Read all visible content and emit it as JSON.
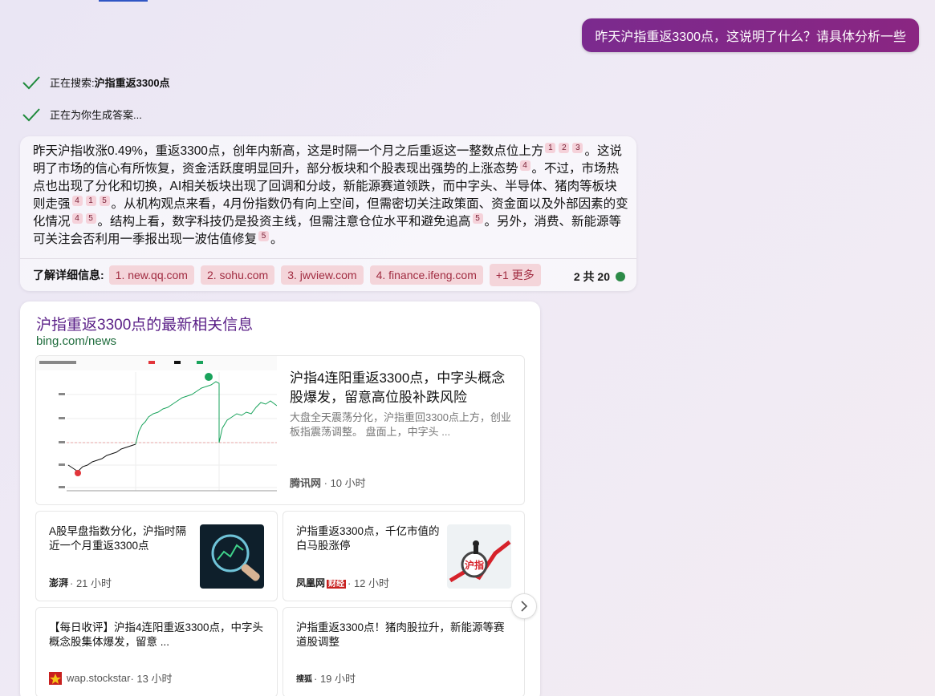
{
  "user_message": "昨天沪指重返3300点，这说明了什么？请具体分析一些",
  "status": {
    "searching_prefix": "正在搜索: ",
    "searching_query": "沪指重返3300点",
    "generating": "正在为你生成答案..."
  },
  "answer": {
    "s1": "昨天沪指收涨0.49%，重返3300点，创年内新高，这是时隔一个月之后重返这一整数点位上方",
    "s2": "。这说明了市场的信心有所恢复，资金活跃度明显回升，部分板块和个股表现出强势的上涨态势",
    "s3": "。不过，市场热点也出现了分化和切换，AI相关板块出现了回调和分歧，新能源赛道领跌，而中字头、半导体、猪肉等板块则走强",
    "s4": "。从机构观点来看，4月份指数仍有向上空间，但需密切关注政策面、资金面以及外部因素的变化情况",
    "s5": "。结构上看，数字科技仍是投资主线，但需注意仓位水平和避免追高",
    "s6": "。另外，消费、新能源等可关注会否利用一季报出现一波估值修复",
    "s7": "。",
    "cites": [
      "1",
      "2",
      "3",
      "4",
      "4",
      "1",
      "5",
      "4",
      "5",
      "5",
      "5"
    ]
  },
  "learn_more": {
    "label": "了解详细信息:",
    "chips": [
      "1. new.qq.com",
      "2. sohu.com",
      "3. jwview.com",
      "4. finance.ifeng.com",
      "+1 更多"
    ],
    "count": "2 共 20"
  },
  "news": {
    "title": "沪指重返3300点的最新相关信息",
    "source": "bing.com/news",
    "feature": {
      "title": "沪指4连阳重返3300点，中字头概念股爆发，留意高位股补跌风险",
      "snippet": "大盘全天震荡分化，沪指重回3300点上方，创业板指震荡调整。 盘面上，中字头 ...",
      "source": "腾讯网",
      "time": " · 10 小时"
    },
    "cards": [
      {
        "title": "A股早盘指数分化，沪指时隔近一个月重返3300点",
        "source": "澎湃",
        "time": " · 21 小时"
      },
      {
        "title": "沪指重返3300点，千亿市值的白马股涨停",
        "source": "凤凰网",
        "source_tag": "财经",
        "time": " · 12 小时",
        "thumb_text": "沪指"
      },
      {
        "title": "【每日收评】沪指4连阳重返3300点，中字头概念股集体爆发，留意 ...",
        "source": "wap.stockstar",
        "time": " · 13 小时"
      },
      {
        "title": "沪指重返3300点！猪肉股拉升，新能源等赛道股调整",
        "source": "搜狐",
        "time": " · 19 小时"
      }
    ]
  }
}
